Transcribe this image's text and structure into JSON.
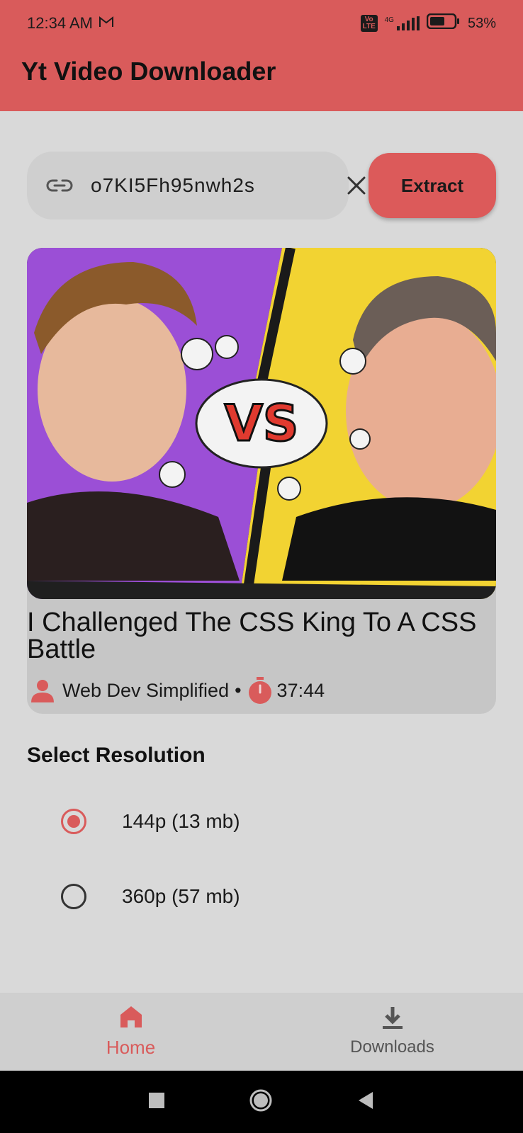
{
  "status_bar": {
    "time": "12:34 AM",
    "network": "4G",
    "volte": "Vo LTE",
    "battery": "53%"
  },
  "app": {
    "title": "Yt Video Downloader",
    "accent_color": "#d95b5b"
  },
  "url_input": {
    "value": "o7KI5Fh95nwh2s"
  },
  "extract_button": {
    "label": "Extract"
  },
  "video": {
    "title": "I Challenged The CSS King To A CSS Battle",
    "channel": "Web Dev Simplified",
    "separator": "•",
    "duration": "37:44",
    "thumbnail_text": "VS"
  },
  "resolution": {
    "heading": "Select Resolution",
    "options": [
      {
        "label": "144p (13 mb)",
        "selected": true
      },
      {
        "label": "360p (57 mb)",
        "selected": false
      }
    ]
  },
  "bottom_nav": {
    "items": [
      {
        "label": "Home",
        "icon": "home-icon",
        "active": true
      },
      {
        "label": "Downloads",
        "icon": "download-icon",
        "active": false
      }
    ]
  }
}
